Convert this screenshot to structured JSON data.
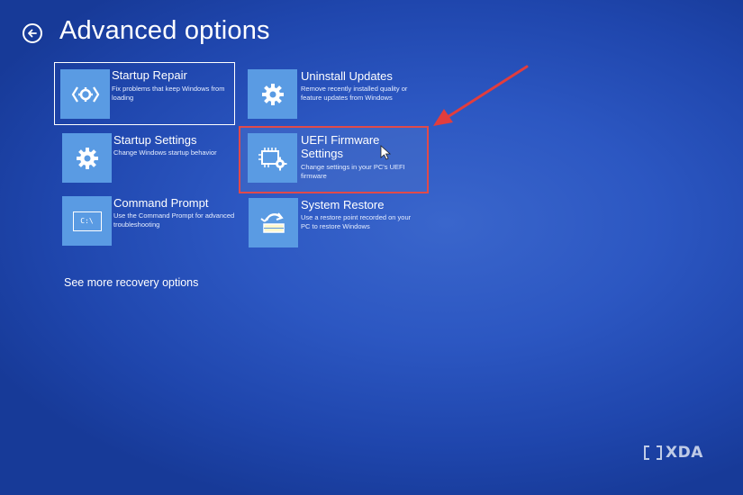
{
  "header": {
    "title": "Advanced options",
    "back_icon": "back-arrow-circle-icon"
  },
  "tiles": [
    {
      "title": "Startup Repair",
      "description": "Fix problems that keep Windows from loading",
      "icon": "gear-brackets-icon"
    },
    {
      "title": "Uninstall Updates",
      "description": "Remove recently installed quality or feature updates from Windows",
      "icon": "gear-icon"
    },
    {
      "title": "Startup Settings",
      "description": "Change Windows startup behavior",
      "icon": "gear-icon"
    },
    {
      "title": "UEFI Firmware Settings",
      "description": "Change settings in your PC's UEFI firmware",
      "icon": "chip-gear-icon"
    },
    {
      "title": "Command Prompt",
      "description": "Use the Command Prompt for advanced troubleshooting",
      "icon": "terminal-icon",
      "icon_text": "C:\\"
    },
    {
      "title": "System Restore",
      "description": "Use a restore point recorded on your PC to restore Windows",
      "icon": "restore-icon"
    }
  ],
  "more_link": "See more recovery options",
  "watermark": {
    "text": "XDA"
  },
  "colors": {
    "background": "#2c57c2",
    "tile_icon_bg": "#5a9be3",
    "highlight_red": "#e04a4a"
  }
}
